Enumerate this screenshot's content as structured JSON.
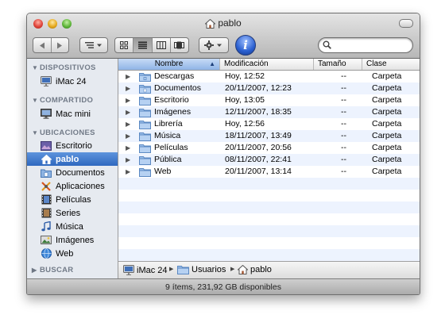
{
  "window": {
    "title": "pablo",
    "status": "9 ítems, 231,92 GB disponibles"
  },
  "toolbar": {
    "buttons": [
      "back-icon",
      "forward-icon",
      "path-menu-icon",
      "icon-view-icon",
      "list-view-icon",
      "column-view-icon",
      "coverflow-view-icon",
      "gear-icon",
      "info-icon",
      "search-icon"
    ],
    "active_view": "list",
    "info_label": "i",
    "search_value": ""
  },
  "sidebar": {
    "sections": [
      {
        "label": "DISPOSITIVOS",
        "items": [
          {
            "label": "iMac 24",
            "icon": "imac-icon"
          }
        ]
      },
      {
        "label": "COMPARTIDO",
        "items": [
          {
            "label": "Mac mini",
            "icon": "display-icon"
          }
        ]
      },
      {
        "label": "UBICACIONES",
        "items": [
          {
            "label": "Escritorio",
            "icon": "desktop-icon"
          },
          {
            "label": "pablo",
            "icon": "home-icon",
            "selected": true
          },
          {
            "label": "Documentos",
            "icon": "documents-icon"
          },
          {
            "label": "Aplicaciones",
            "icon": "applications-icon"
          },
          {
            "label": "Películas",
            "icon": "movies-icon"
          },
          {
            "label": "Series",
            "icon": "series-icon"
          },
          {
            "label": "Música",
            "icon": "music-icon"
          },
          {
            "label": "Imágenes",
            "icon": "pictures-icon"
          },
          {
            "label": "Web",
            "icon": "globe-icon"
          }
        ]
      },
      {
        "label": "BUSCAR",
        "items": []
      }
    ]
  },
  "columns": {
    "name": "Nombre",
    "modified": "Modificación",
    "size": "Tamaño",
    "kind": "Clase"
  },
  "files": [
    {
      "name": "Descargas",
      "modified": "Hoy, 12:52",
      "size": "--",
      "kind": "Carpeta"
    },
    {
      "name": "Documentos",
      "modified": "20/11/2007, 12:23",
      "size": "--",
      "kind": "Carpeta"
    },
    {
      "name": "Escritorio",
      "modified": "Hoy, 13:05",
      "size": "--",
      "kind": "Carpeta"
    },
    {
      "name": "Imágenes",
      "modified": "12/11/2007, 18:35",
      "size": "--",
      "kind": "Carpeta"
    },
    {
      "name": "Librería",
      "modified": "Hoy, 12:56",
      "size": "--",
      "kind": "Carpeta"
    },
    {
      "name": "Música",
      "modified": "18/11/2007, 13:49",
      "size": "--",
      "kind": "Carpeta"
    },
    {
      "name": "Películas",
      "modified": "20/11/2007, 20:56",
      "size": "--",
      "kind": "Carpeta"
    },
    {
      "name": "Pública",
      "modified": "08/11/2007, 22:41",
      "size": "--",
      "kind": "Carpeta"
    },
    {
      "name": "Web",
      "modified": "20/11/2007, 13:14",
      "size": "--",
      "kind": "Carpeta"
    }
  ],
  "pathbar": [
    "iMac 24",
    "Usuarios",
    "pablo"
  ],
  "colors": {
    "selection": "#3a74c9",
    "alt_row": "#edf3fe",
    "sidebar_bg": "#e6eaf0"
  }
}
